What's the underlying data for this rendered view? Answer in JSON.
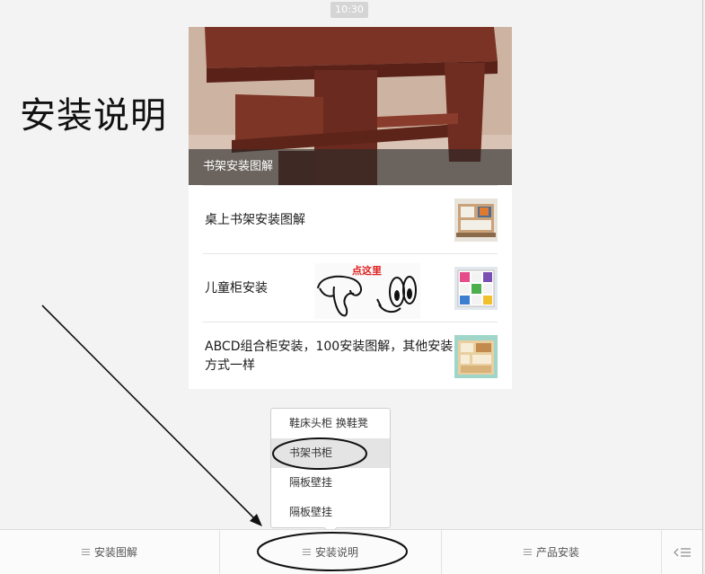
{
  "status": {
    "time": "10:30"
  },
  "annotation": {
    "heading": "安装说明",
    "hint_text": "点这里"
  },
  "article": {
    "cover_caption": "书架安装图解",
    "items": [
      {
        "title": "桌上书架安装图解",
        "thumb": "desk-bookshelf-thumbnail"
      },
      {
        "title": "儿童柜安装",
        "thumb": "kids-cabinet-thumbnail"
      },
      {
        "title": "ABCD组合柜安装，100安装图解，其他安装方式一样",
        "thumb": "combo-cabinet-thumbnail"
      }
    ]
  },
  "submenu": {
    "items": [
      "鞋床头柜 换鞋凳",
      "书架书柜",
      "隔板壁挂",
      "隔板壁挂"
    ],
    "active_index": 1
  },
  "menubar": {
    "buttons": [
      "安装图解",
      "安装说明",
      "产品安装"
    ],
    "keyboard_icon": "keyboard-switch-icon"
  },
  "colors": {
    "background": "#f3f3f3",
    "hint_red": "#e02020",
    "caption_overlay": "#282828"
  }
}
